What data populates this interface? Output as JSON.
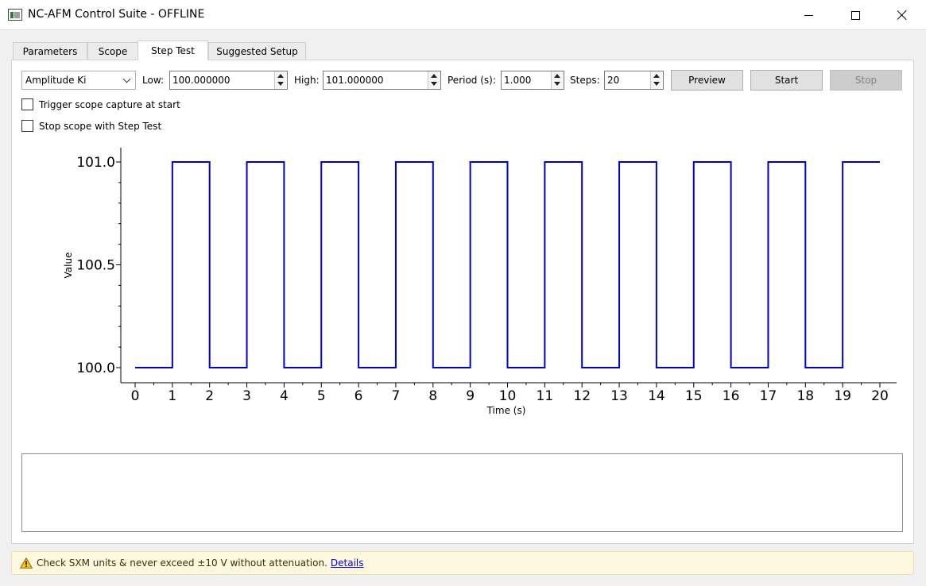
{
  "window": {
    "title": "NC-AFM Control Suite - OFFLINE"
  },
  "tabs": [
    {
      "label": "Parameters"
    },
    {
      "label": "Scope"
    },
    {
      "label": "Step Test",
      "active": true
    },
    {
      "label": "Suggested Setup"
    }
  ],
  "controls": {
    "parameter": "Amplitude Ki",
    "low_label": "Low:",
    "low_value": "100.000000",
    "high_label": "High:",
    "high_value": "101.000000",
    "period_label": "Period (s):",
    "period_value": "1.000",
    "steps_label": "Steps:",
    "steps_value": "20",
    "preview_label": "Preview",
    "start_label": "Start",
    "stop_label": "Stop",
    "trigger_label": "Trigger scope capture at start",
    "stopscope_label": "Stop scope with Step Test"
  },
  "chart_data": {
    "type": "line",
    "step": true,
    "xlabel": "Time (s)",
    "ylabel": "Value",
    "xlim": [
      0,
      20
    ],
    "ylim": [
      100.0,
      101.0
    ],
    "xticks": [
      0,
      1,
      2,
      3,
      4,
      5,
      6,
      7,
      8,
      9,
      10,
      11,
      12,
      13,
      14,
      15,
      16,
      17,
      18,
      19,
      20
    ],
    "yticks": [
      "100.0",
      "100.5",
      "101.0"
    ],
    "series": [
      {
        "color": "#0000cc",
        "x": [
          0,
          1,
          2,
          3,
          4,
          5,
          6,
          7,
          8,
          9,
          10,
          11,
          12,
          13,
          14,
          15,
          16,
          17,
          18,
          19,
          20
        ],
        "y": [
          100,
          101,
          100,
          101,
          100,
          101,
          100,
          101,
          100,
          101,
          100,
          101,
          100,
          101,
          100,
          101,
          100,
          101,
          100,
          101,
          101
        ]
      }
    ]
  },
  "warning": {
    "text": "Check SXM units & never exceed ±10 V without attenuation.",
    "link": "Details"
  },
  "colors": {
    "line": "#0000cc",
    "warning_bg": "#fff8e1"
  }
}
